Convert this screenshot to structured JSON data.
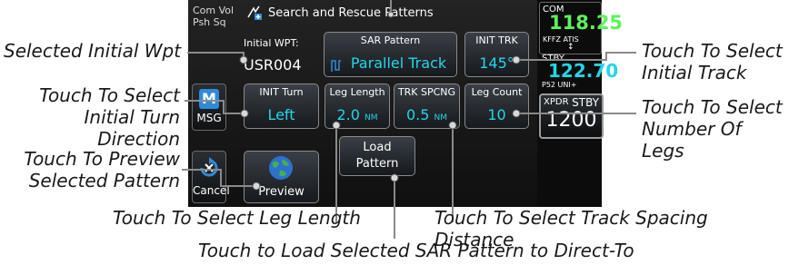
{
  "screen": {
    "title": "Search and Rescue Patterns",
    "com_vol_line1": "Com Vol",
    "com_vol_line2": "Psh Sq",
    "initial_wpt_label": "Initial WPT:",
    "initial_wpt_value": "USR004",
    "sar_pattern_label": "SAR Pattern",
    "sar_pattern_value": "Parallel Track",
    "init_trk_label": "INIT TRK",
    "init_trk_value": "145°",
    "init_turn_label": "INIT Turn",
    "init_turn_value": "Left",
    "leg_length_label": "Leg Length",
    "leg_length_value": "2.0",
    "leg_length_unit": "NM",
    "trk_spcng_label": "TRK SPCNG",
    "trk_spcng_value": "0.5",
    "trk_spcng_unit": "NM",
    "leg_count_label": "Leg Count",
    "leg_count_value": "10",
    "msg_label": "MSG",
    "cancel_label": "Cancel",
    "preview_label": "Preview",
    "load_label_1": "Load",
    "load_label_2": "Pattern",
    "com_label": "COM",
    "com_freq": "118.25",
    "com_id": "KFFZ ATIS",
    "stby_label": "STBY",
    "stby_freq": "122.70",
    "stby_id": "P52 UNI+",
    "xpdr_label": "XPDR",
    "xpdr_mode": "STBY",
    "xpdr_code": "1200",
    "msg_icon_letter": "M",
    "colors": {
      "accent": "#22d6e8",
      "com_green": "#5cf25c",
      "background": "#111111"
    }
  },
  "annotations": {
    "selected_initial_wpt": "Selected Initial Wpt",
    "initial_turn_1": "Touch To Select",
    "initial_turn_2": "Initial Turn Direction",
    "preview_1": "Touch To Preview",
    "preview_2": "Selected Pattern",
    "initial_track_1": "Touch To Select",
    "initial_track_2": "Initial Track",
    "num_legs_1": "Touch To Select",
    "num_legs_2": "Number Of Legs",
    "leg_length": "Touch To Select Leg Length",
    "track_spacing": "Touch To Select Track Spacing Distance",
    "load_pattern": "Touch to Load Selected SAR Pattern to Direct-To"
  }
}
